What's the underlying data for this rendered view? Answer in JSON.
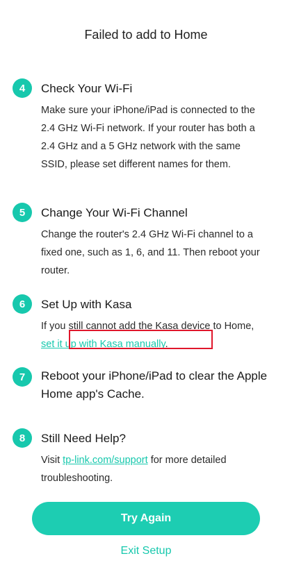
{
  "header": {
    "title": "Failed to add to Home"
  },
  "steps": [
    {
      "number": "4",
      "title": "Check Your Wi-Fi",
      "body": "Make sure your iPhone/iPad is connected to the 2.4 GHz Wi-Fi network. If your router has both a 2.4 GHz and a 5 GHz network with the same SSID, please set different names for them."
    },
    {
      "number": "5",
      "title": "Change Your Wi-Fi Channel",
      "body": "Change the router's 2.4 GHz Wi-Fi channel to a fixed one, such as 1, 6, and 11. Then reboot your router."
    },
    {
      "number": "6",
      "title": "Set Up with Kasa",
      "body_prefix": "If you still cannot add the Kasa device to Home, ",
      "link": "set it up with Kasa manually",
      "body_suffix": "."
    },
    {
      "number": "7",
      "title": "Reboot your iPhone/iPad to clear the Apple Home app's Cache."
    },
    {
      "number": "8",
      "title": "Still Need Help?",
      "body_prefix": "Visit ",
      "link": "tp-link.com/support",
      "body_suffix": " for more detailed troubleshooting."
    }
  ],
  "actions": {
    "primary": "Try Again",
    "secondary": "Exit Setup"
  },
  "colors": {
    "accent": "#17c8ad",
    "highlight": "#e0162b"
  }
}
